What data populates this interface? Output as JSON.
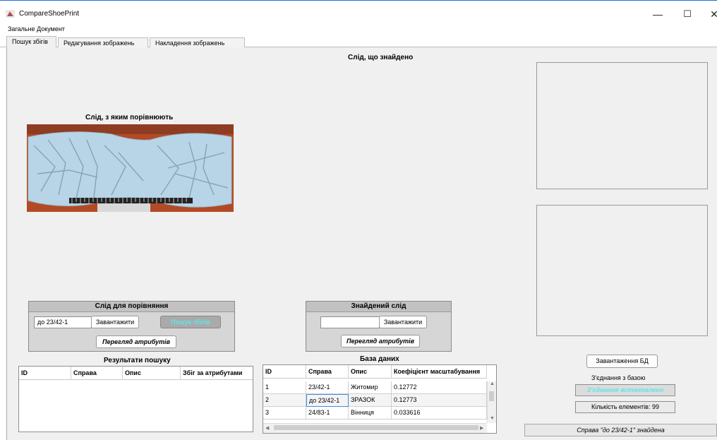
{
  "window": {
    "title": "CompareShoePrint",
    "min": "—",
    "max": "☐",
    "close": "✕"
  },
  "menu": [
    "Загальне",
    "Документ"
  ],
  "tabs": [
    "Пошук збігів",
    "Редагування зображень",
    "Накладення зображень"
  ],
  "labels": {
    "found_trace": "Слід, що знайдено",
    "compared_trace": "Слід, з яким порівнюють"
  },
  "compare_panel": {
    "title": "Слід для порівняння",
    "input_value": "до 23/42-1",
    "load_label": "Завантажити",
    "search_label": "Пошук збігів",
    "attrs_label": "Перегляд атрибутів"
  },
  "found_panel": {
    "title": "Знайдений слід",
    "input_value": "",
    "load_label": "Завантажити",
    "attrs_label": "Перегляд атрибутів"
  },
  "results": {
    "title": "Результати пошуку",
    "columns": [
      "ID",
      "Справа",
      "Опис",
      "Збіг за атрибутами"
    ]
  },
  "database": {
    "title": "База даних",
    "columns": [
      "ID",
      "Справа",
      "Опис",
      "Коефіцієнт масштабування"
    ],
    "rows": [
      [
        "1",
        "23/42-1",
        "Житомир",
        "0.12772"
      ],
      [
        "2",
        "до 23/42-1",
        "ЗРАЗОК",
        "0.12773"
      ],
      [
        "3",
        "24/83-1",
        "Вінниця",
        "0.033616"
      ]
    ]
  },
  "db_side": {
    "load_db_label": "Завантаження БД",
    "connection_label": "З'єднання з базою",
    "connection_status": "З'єднання встановлено",
    "count_label": "Кількість елементів: 99"
  },
  "status_text": "Справа \"до 23/42-1\" знайдена",
  "colors": {
    "accent": "#1e6fd9",
    "status_cyan": "#5ee6e6",
    "sole_blue": "#b7d5e6",
    "table_bg": "#c94a1c"
  }
}
